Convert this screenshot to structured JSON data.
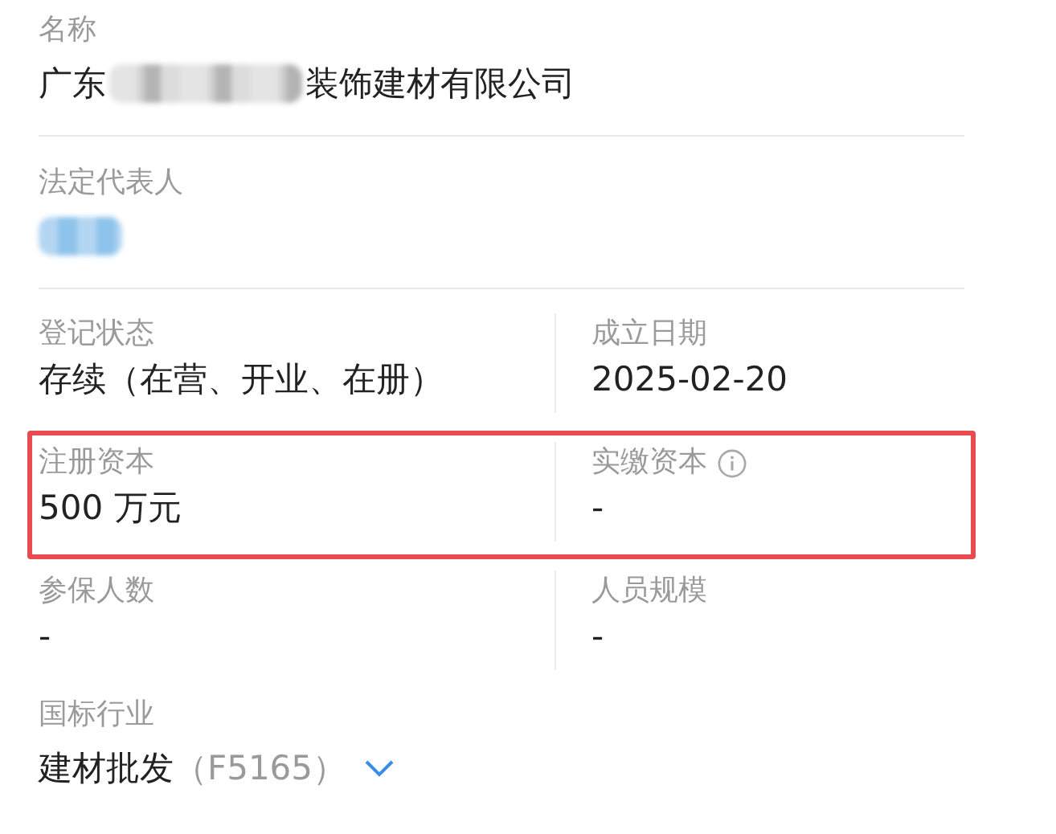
{
  "company_name": {
    "label": "名称",
    "value_start": "广东",
    "redacted": true,
    "value_end": "装饰建材有限公司"
  },
  "legal_representative": {
    "label": "法定代表人",
    "redacted": true
  },
  "field_rows": [
    {
      "highlighted": false,
      "fields": [
        {
          "label": "登记状态",
          "value": "存续（在营、开业、在册）",
          "info": false
        },
        {
          "label": "成立日期",
          "value": "2025-02-20",
          "info": false
        }
      ]
    },
    {
      "highlighted": true,
      "fields": [
        {
          "label": "注册资本",
          "value": "500 万元",
          "info": false
        },
        {
          "label": "实缴资本",
          "value": "-",
          "info": true
        }
      ]
    },
    {
      "highlighted": false,
      "fields": [
        {
          "label": "参保人数",
          "value": "-",
          "info": false
        },
        {
          "label": "人员规模",
          "value": "-",
          "info": false
        }
      ]
    }
  ],
  "industry": {
    "label": "国标行业",
    "value": "建材批发",
    "code": "（F5165）",
    "expanded": false
  }
}
